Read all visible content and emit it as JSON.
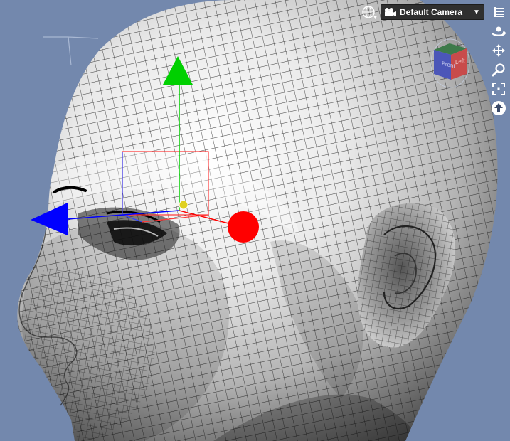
{
  "viewport": {
    "background_color": "#7388ad",
    "camera_label": "Default Camera",
    "camera_icon": "movie-camera-icon",
    "perspective_icon": "globe-icon",
    "dropdown_icon": "chevron-down-icon"
  },
  "nav_cube": {
    "faces": [
      "Front",
      "Left"
    ],
    "colors": {
      "top": "#3d7a4a",
      "front": "#4b56b8",
      "left": "#c84b4b"
    }
  },
  "tools": [
    {
      "name": "view-menu-icon"
    },
    {
      "name": "orbit-icon"
    },
    {
      "name": "pan-icon"
    },
    {
      "name": "zoom-icon"
    },
    {
      "name": "frame-icon"
    },
    {
      "name": "aim-icon"
    }
  ],
  "gizmo": {
    "x_axis_color": "#ff0000",
    "y_axis_color": "#00d000",
    "z_axis_color": "#0000ff",
    "center_color": "#e0d020"
  }
}
